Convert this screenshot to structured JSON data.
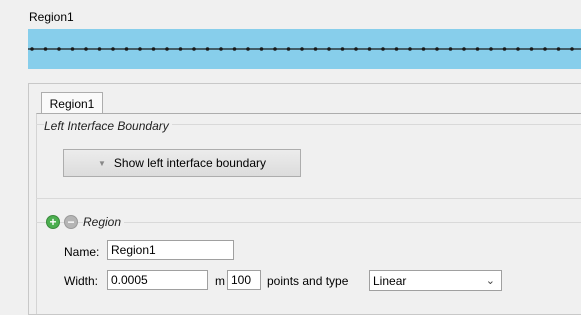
{
  "title": "Region1",
  "tab_label": "Region1",
  "left_boundary_group": {
    "label": "Left Interface Boundary",
    "button_label": "Show left interface boundary"
  },
  "region_group": {
    "label": "Region",
    "name_label": "Name:",
    "name_value": "Region1",
    "width_label": "Width:",
    "width_value": "0.0005",
    "width_unit": "m",
    "points_value": "100",
    "points_type_label": "points and type",
    "type_selected": "Linear"
  },
  "icons": {
    "add": "plus-circle-icon",
    "remove": "minus-circle-icon",
    "dropdown": "chevron-down-icon",
    "expand": "triangle-down-icon"
  },
  "colors": {
    "mesh_background": "#87ceeb",
    "mesh_line": "#1a1a1a",
    "add_icon": "#4caf50",
    "remove_icon": "#b5b5b5"
  }
}
